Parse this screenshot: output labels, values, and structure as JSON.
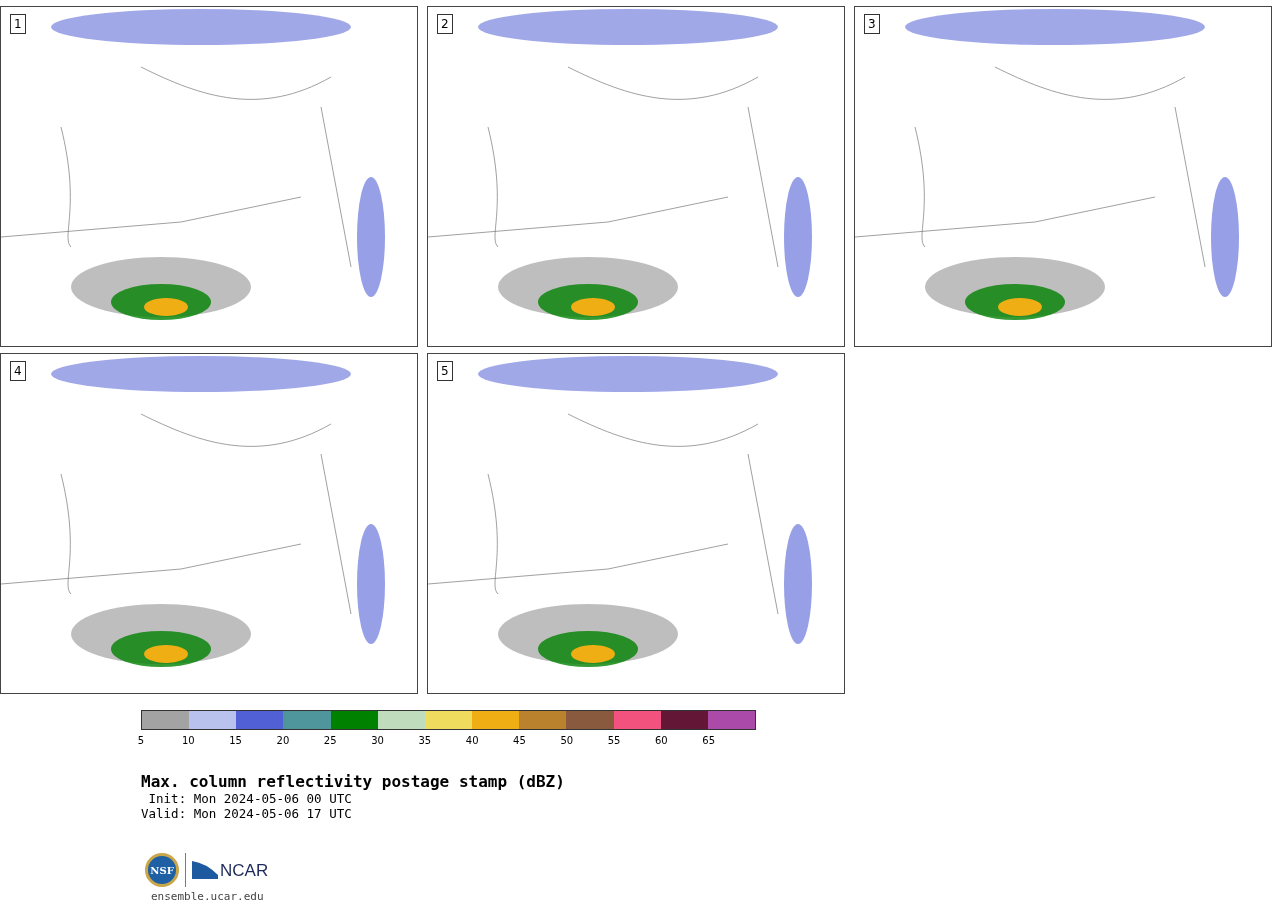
{
  "panels": [
    {
      "label": "1"
    },
    {
      "label": "2"
    },
    {
      "label": "3"
    },
    {
      "label": "4"
    },
    {
      "label": "5"
    }
  ],
  "colorbar": {
    "segments": [
      {
        "color": "#a3a3a3"
      },
      {
        "color": "#b8c2ec"
      },
      {
        "color": "#5260d6"
      },
      {
        "color": "#4f969c"
      },
      {
        "color": "#018100"
      },
      {
        "color": "#bfdcbd"
      },
      {
        "color": "#efdb5d"
      },
      {
        "color": "#f0ae15"
      },
      {
        "color": "#bb822e"
      },
      {
        "color": "#8a5a3e"
      },
      {
        "color": "#f4527e"
      },
      {
        "color": "#641637"
      },
      {
        "color": "#ab4aa8"
      }
    ],
    "ticks": [
      "5",
      "10",
      "15",
      "20",
      "25",
      "30",
      "35",
      "40",
      "45",
      "50",
      "55",
      "60",
      "65"
    ]
  },
  "title": "Max. column reflectivity postage stamp (dBZ)",
  "init": " Init: Mon 2024-05-06 00 UTC",
  "valid": "Valid: Mon 2024-05-06 17 UTC",
  "logos": {
    "nsf": "NSF",
    "ncar": "NCAR"
  },
  "site": "ensemble.ucar.edu"
}
